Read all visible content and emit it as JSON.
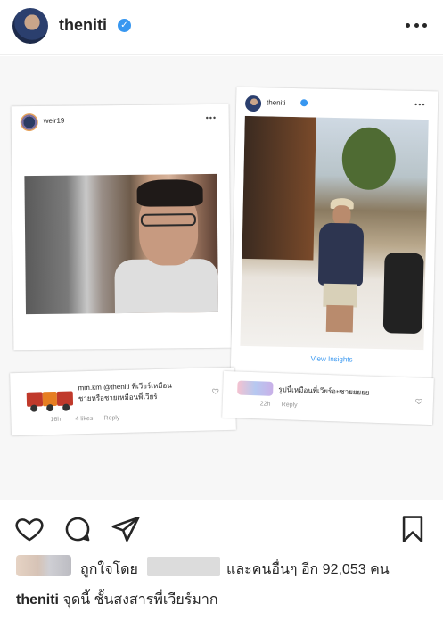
{
  "header": {
    "username": "theniti",
    "verified": true,
    "more_icon": "more-horizontal-icon"
  },
  "post": {
    "left_card": {
      "username": "weir19",
      "more": "•••"
    },
    "right_card": {
      "username": "theniti",
      "more": "•••",
      "view_insights": "View Insights"
    },
    "comment_left": {
      "text": "mm.km @theniti พี่เวียร์เหมือน",
      "text2": "ชายหรือชายเหมือนพี่เวียร์",
      "time": "16h",
      "likes": "4 likes",
      "reply": "Reply"
    },
    "comment_right": {
      "text": "รูปนี้เหมือนพี่เวียร์อะชายยยยย",
      "time": "22h",
      "reply": "Reply"
    }
  },
  "actions": {
    "like_icon": "heart-icon",
    "comment_icon": "comment-icon",
    "share_icon": "send-icon",
    "save_icon": "bookmark-icon"
  },
  "likes": {
    "prefix": "ถูกใจโดย",
    "suffix": "และคนอื่นๆ อีก 92,053 คน"
  },
  "caption": {
    "username": "theniti",
    "text": "จุดนี้ ชั้นสงสารพี่เวียร์มาก"
  },
  "colors": {
    "accent": "#3897f0",
    "text": "#262626"
  }
}
